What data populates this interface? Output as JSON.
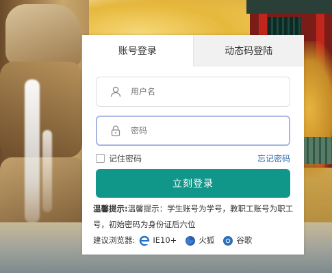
{
  "tabs": [
    {
      "label": "账号登录",
      "active": true
    },
    {
      "label": "动态码登陆",
      "active": false
    }
  ],
  "form": {
    "username_placeholder": "用户名",
    "password_placeholder": "密码",
    "remember_label": "记住密码",
    "forgot_label": "忘记密码",
    "login_label": "立刻登录"
  },
  "tips": {
    "label": "温馨提示:",
    "text": "温馨提示：学生账号为学号，教职工账号为职工号，初始密码为身份证后六位",
    "browsers_label": "建议浏览器:",
    "browsers": [
      {
        "name": "IE10+",
        "icon": "ie-icon"
      },
      {
        "name": "火狐",
        "icon": "firefox-icon"
      },
      {
        "name": "谷歌",
        "icon": "chrome-icon"
      }
    ]
  },
  "colors": {
    "accent": "#11968a",
    "link": "#2b6aa8"
  }
}
